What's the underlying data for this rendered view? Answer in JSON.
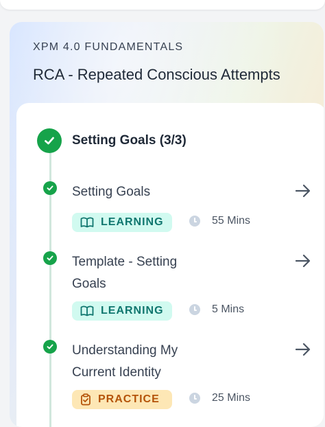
{
  "course": {
    "kicker": "XPM 4.0 FUNDAMENTALS",
    "title": "RCA - Repeated Conscious Attempts"
  },
  "section": {
    "title": "Setting Goals (3/3)"
  },
  "items": [
    {
      "title_line1": "Setting Goals",
      "title_line2": "",
      "badge": "LEARNING",
      "badge_icon": "book-open-icon",
      "duration": "55 Mins"
    },
    {
      "title_line1": "Template - Setting",
      "title_line2": "Goals",
      "badge": "LEARNING",
      "badge_icon": "book-open-icon",
      "duration": "5 Mins"
    },
    {
      "title_line1": "Understanding My",
      "title_line2": "Current Identity",
      "badge": "PRACTICE",
      "badge_icon": "clipboard-check-icon",
      "duration": "25 Mins"
    }
  ],
  "colors": {
    "complete_green": "#16a34a",
    "learning_bg": "#d1faf0",
    "learning_text": "#0f766e",
    "practice_bg": "#fde7b5",
    "practice_text": "#b45309"
  }
}
